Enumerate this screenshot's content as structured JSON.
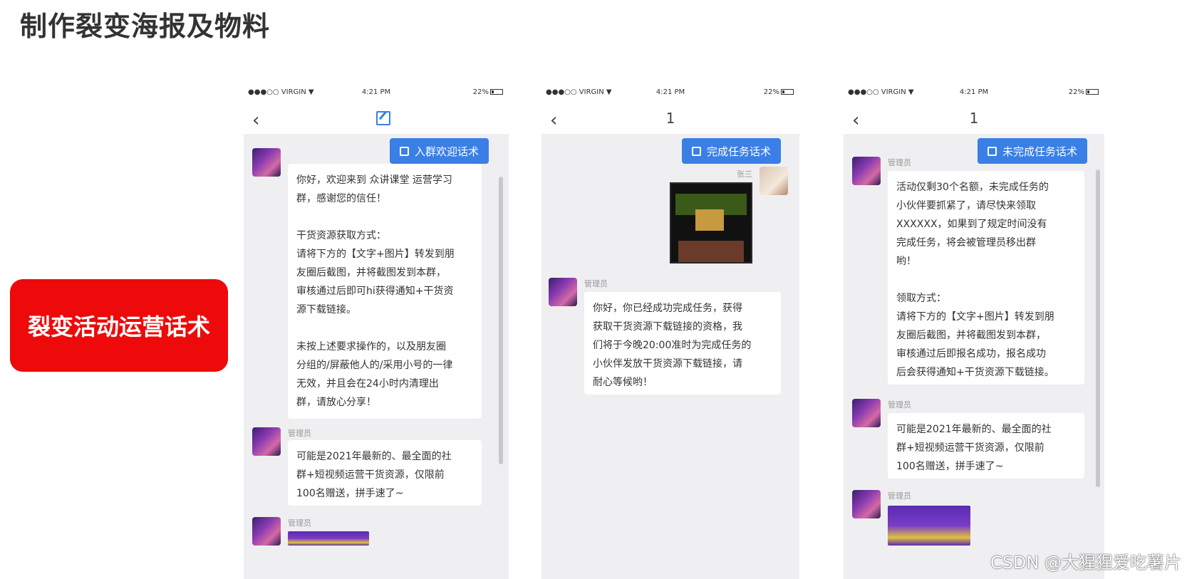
{
  "page": {
    "title": "制作裂变海报及物料",
    "side_card": "裂变活动运营话术",
    "watermark": "CSDN @大猩猩爱吃薯片"
  },
  "phones": [
    {
      "status": {
        "carrier": "●●●○○ VIRGIN ▼",
        "time": "4:21 PM",
        "battery": "22%"
      },
      "nav_title": "",
      "tag": "入群欢迎话术",
      "messages": [
        {
          "name": "",
          "text": "你好，欢迎来到 众讲课堂 运营学习\n群，感谢您的信任！\n\n干货资源获取方式：\n请将下方的【文字+图片】转发到朋\n友圈后截图，并将截图发到本群，\n审核通过后即可hi获得通知+干货资\n源下载链接。\n\n未按上述要求操作的，以及朋友圈\n分组的/屏蔽他人的/采用小号的一律\n无效，并且会在24小时内清理出\n群，请放心分享！"
        },
        {
          "name": "管理员",
          "text": "可能是2021年最新的、最全面的社\n群+短视频运营干货资源，仅限前\n100名赠送，拼手速了~"
        },
        {
          "name": "管理员",
          "text": ""
        }
      ]
    },
    {
      "status": {
        "carrier": "●●●○○ VIRGIN ▼",
        "time": "4:21 PM",
        "battery": "22%"
      },
      "nav_title": "1",
      "tag": "完成任务话术",
      "messages": [
        {
          "name": "张三",
          "text": ""
        },
        {
          "name": "管理员",
          "text": "你好，你已经成功完成任务，获得\n获取干货资源下载链接的资格，我\n们将于今晚20:00准时为完成任务的\n小伙伴发放干货资源下载链接，请\n耐心等候哟！"
        }
      ]
    },
    {
      "status": {
        "carrier": "●●●○○ VIRGIN ▼",
        "time": "4:21 PM",
        "battery": "22%"
      },
      "nav_title": "1",
      "tag": "未完成任务话术",
      "messages": [
        {
          "name": "管理员",
          "text": "活动仅剩30个名额，未完成任务的\n小伙伴要抓紧了，请尽快来领取\nXXXXXX，如果到了规定时间没有\n完成任务，将会被管理员移出群\n哟！\n\n领取方式：\n请将下方的【文字+图片】转发到朋\n友圈后截图，并将截图发到本群，\n审核通过后即报名成功，报名成功\n后会获得通知+干货资源下载链接。"
        },
        {
          "name": "管理员",
          "text": "可能是2021年最新的、最全面的社\n群+短视频运营干货资源，仅限前\n100名赠送，拼手速了~"
        },
        {
          "name": "管理员",
          "text": ""
        }
      ]
    }
  ]
}
